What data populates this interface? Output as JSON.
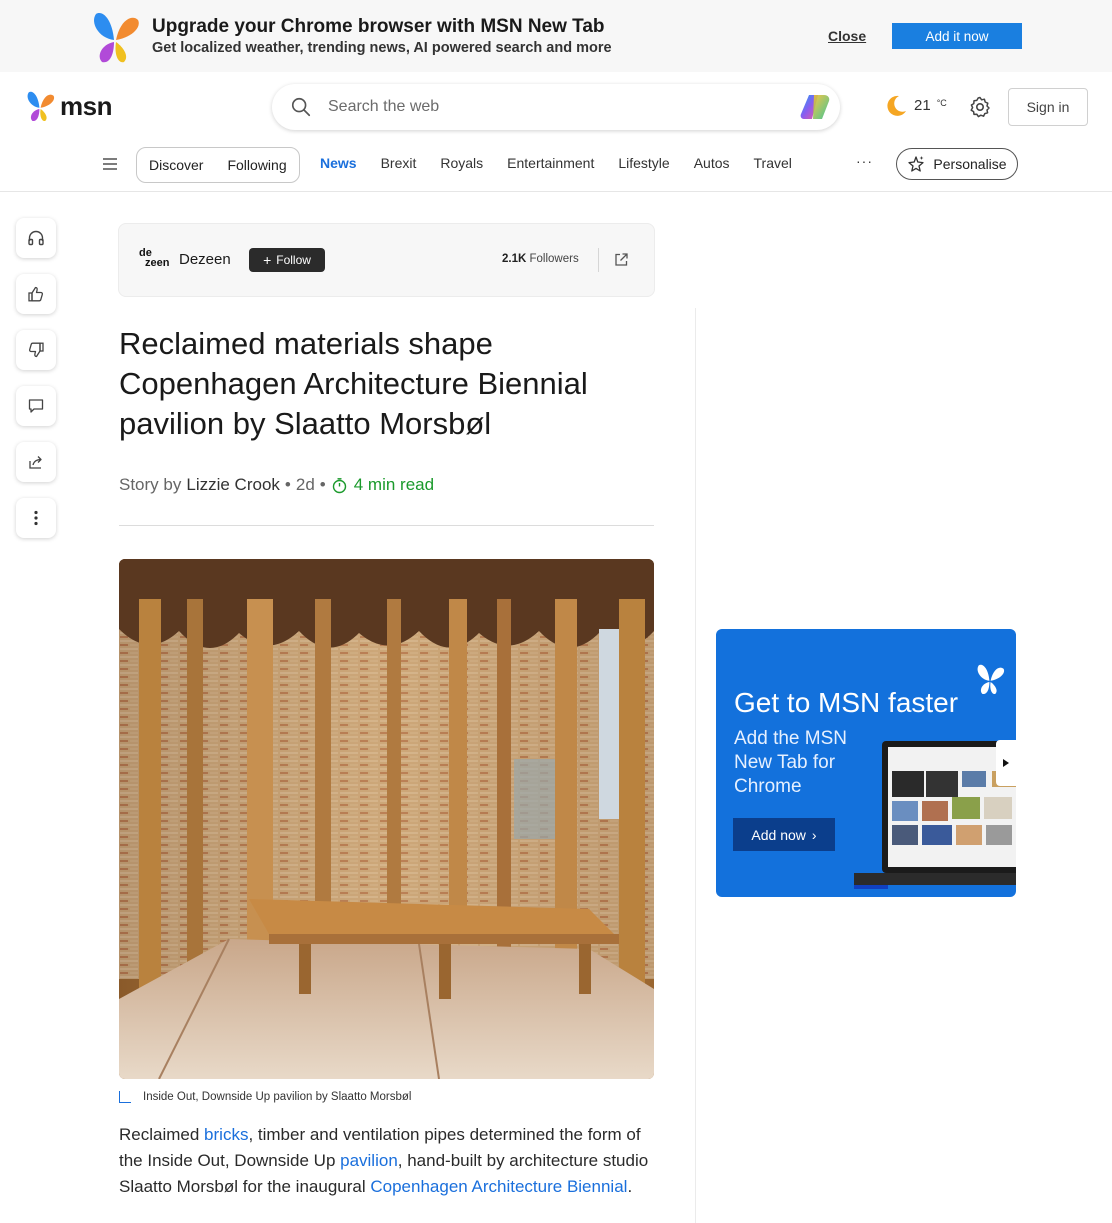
{
  "promo": {
    "title": "Upgrade your Chrome browser with MSN New Tab",
    "subtitle": "Get localized weather, trending news, AI powered search and more",
    "close_label": "Close",
    "add_label": "Add it now"
  },
  "header": {
    "logo_text": "msn",
    "search_placeholder": "Search the web",
    "weather_temp": "21",
    "weather_unit": "°C",
    "signin_label": "Sign in"
  },
  "nav": {
    "pills": [
      "Discover",
      "Following"
    ],
    "links": [
      "News",
      "Brexit",
      "Royals",
      "Entertainment",
      "Lifestyle",
      "Autos",
      "Travel"
    ],
    "active": "News",
    "more": "···",
    "personalise_label": "Personalise"
  },
  "publisher": {
    "logo_line1": "de",
    "logo_line2": "zeen",
    "name": "Dezeen",
    "follow_label": "Follow",
    "followers_count": "2.1K",
    "followers_label": "Followers"
  },
  "article": {
    "headline": "Reclaimed materials shape Copenhagen Architecture Biennial pavilion by Slaatto Morsbøl",
    "story_by": "Story by",
    "author": "Lizzie Crook",
    "age": "2d",
    "read_time": "4 min read",
    "caption": "Inside Out, Downside Up pavilion by Slaatto Morsbøl",
    "body": {
      "p1": "Reclaimed ",
      "link1": "bricks",
      "p2": ", timber and ventilation pipes determined the form of the Inside Out, Downside Up ",
      "link2": "pavilion",
      "p3": ", hand-built by architecture studio Slaatto Morsbøl for the inaugural ",
      "link3": "Copenhagen Architecture Biennial",
      "p4": "."
    }
  },
  "ad": {
    "title": "Get to MSN faster",
    "subtitle": "Add the MSN New Tab for Chrome",
    "button_label": "Add now"
  },
  "colors": {
    "accent_blue": "#1a6fdc",
    "read_green": "#1b9a2c",
    "ad_blue": "#1371dc"
  }
}
